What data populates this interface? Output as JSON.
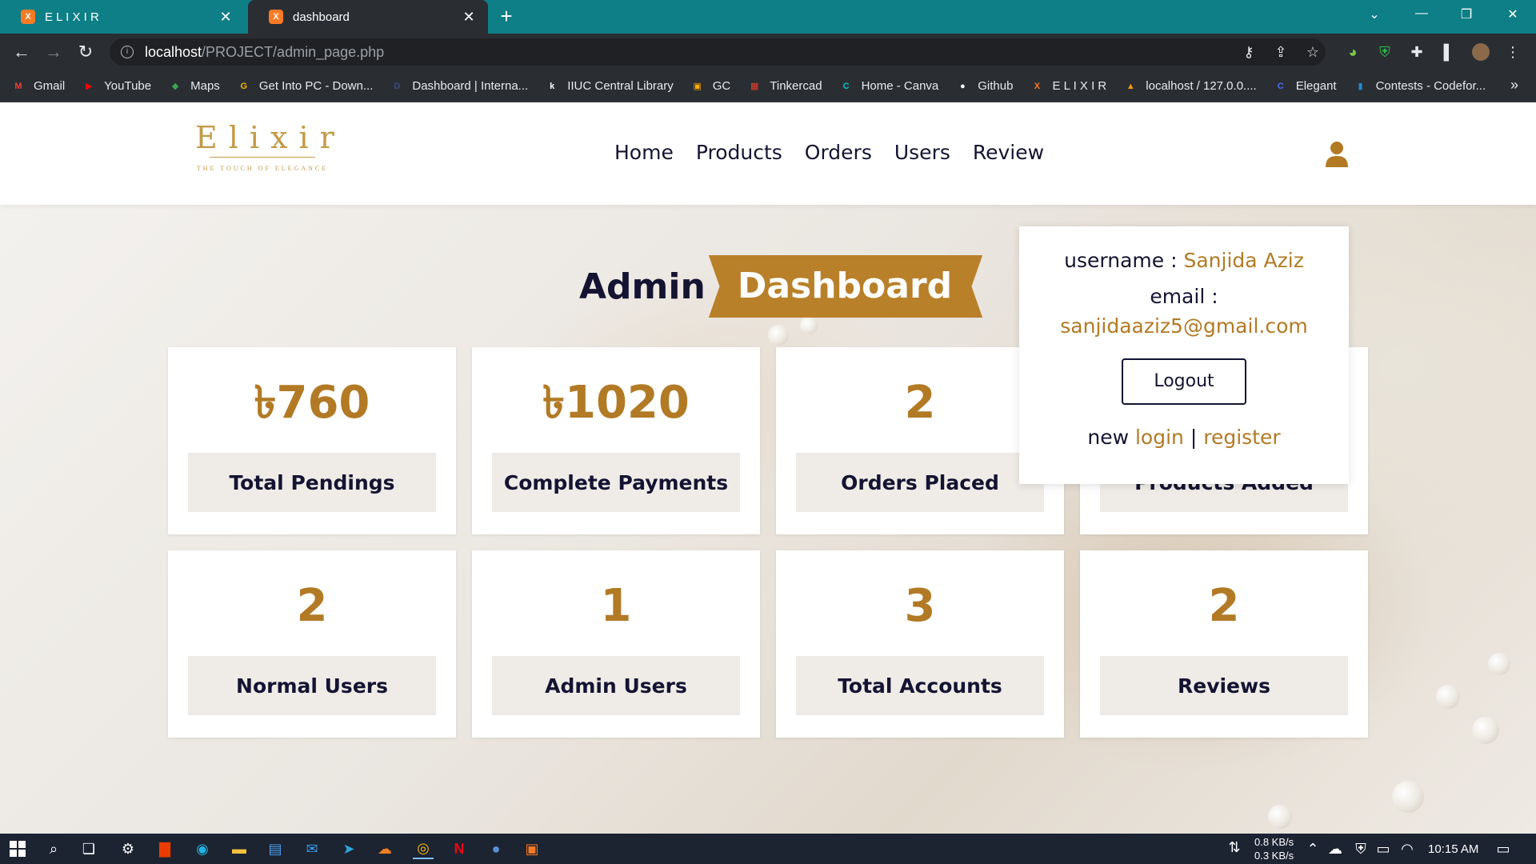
{
  "browser": {
    "tabs": [
      {
        "title": "E L I X I R",
        "close": "✕"
      },
      {
        "title": "dashboard",
        "close": "✕"
      }
    ],
    "new_tab": "+",
    "url": {
      "host": "localhost",
      "path": "/PROJECT/admin_page.php"
    },
    "bookmarks": [
      {
        "label": "Gmail",
        "icon": "gmail-icon",
        "color": "#ea4335",
        "glyph": "M"
      },
      {
        "label": "YouTube",
        "icon": "youtube-icon",
        "color": "#ff0000",
        "glyph": "▶"
      },
      {
        "label": "Maps",
        "icon": "maps-icon",
        "color": "#34a853",
        "glyph": "◆"
      },
      {
        "label": "Get Into PC - Down...",
        "icon": "getintopc-icon",
        "color": "#f4b400",
        "glyph": "G"
      },
      {
        "label": "Dashboard | Interna...",
        "icon": "dashboard-icon",
        "color": "#3c4a8a",
        "glyph": "D"
      },
      {
        "label": "IIUC Central Library",
        "icon": "library-icon",
        "color": "#ffffff",
        "glyph": "k"
      },
      {
        "label": "GC",
        "icon": "classroom-icon",
        "color": "#f9ab00",
        "glyph": "▣"
      },
      {
        "label": "Tinkercad",
        "icon": "tinkercad-icon",
        "color": "#e3412f",
        "glyph": "▦"
      },
      {
        "label": "Home - Canva",
        "icon": "canva-icon",
        "color": "#00c4cc",
        "glyph": "C"
      },
      {
        "label": "Github",
        "icon": "github-icon",
        "color": "#ffffff",
        "glyph": "●"
      },
      {
        "label": "E L I X I R",
        "icon": "xampp-icon",
        "color": "#fb7a24",
        "glyph": "X"
      },
      {
        "label": "localhost / 127.0.0....",
        "icon": "phpmyadmin-icon",
        "color": "#f89c0e",
        "glyph": "▲"
      },
      {
        "label": "Elegant",
        "icon": "elegant-icon",
        "color": "#4a6cf7",
        "glyph": "C"
      },
      {
        "label": "Contests - Codefor...",
        "icon": "codeforces-icon",
        "color": "#1f8acb",
        "glyph": "▮"
      }
    ],
    "bookmarks_more": "»"
  },
  "site": {
    "logo_text": "Elixir",
    "logo_tagline": "THE TOUCH OF ELEGANCE",
    "nav": [
      "Home",
      "Products",
      "Orders",
      "Users",
      "Review"
    ]
  },
  "dashboard": {
    "title_part1": "Admin",
    "title_part2": "Dashboard",
    "cards": [
      {
        "value": "৳760",
        "label": "Total Pendings"
      },
      {
        "value": "৳1020",
        "label": "Complete Payments"
      },
      {
        "value": "2",
        "label": "Orders Placed"
      },
      {
        "value": "",
        "label": "Products Added"
      },
      {
        "value": "2",
        "label": "Normal Users"
      },
      {
        "value": "1",
        "label": "Admin Users"
      },
      {
        "value": "3",
        "label": "Total Accounts"
      },
      {
        "value": "2",
        "label": "Reviews"
      }
    ]
  },
  "profile": {
    "username_label": "username :",
    "username": "Sanjida Aziz",
    "email_label": "email :",
    "email": "sanjidaaziz5@gmail.com",
    "logout": "Logout",
    "new_label": "new",
    "login": "login",
    "separator": "|",
    "register": "register"
  },
  "taskbar": {
    "net_down": "0.8 KB/s",
    "net_up": "0.3 KB/s",
    "time": "10:15 AM"
  },
  "colors": {
    "accent": "#b27a25",
    "navy": "#141432",
    "chrome": "#0e7f86"
  }
}
